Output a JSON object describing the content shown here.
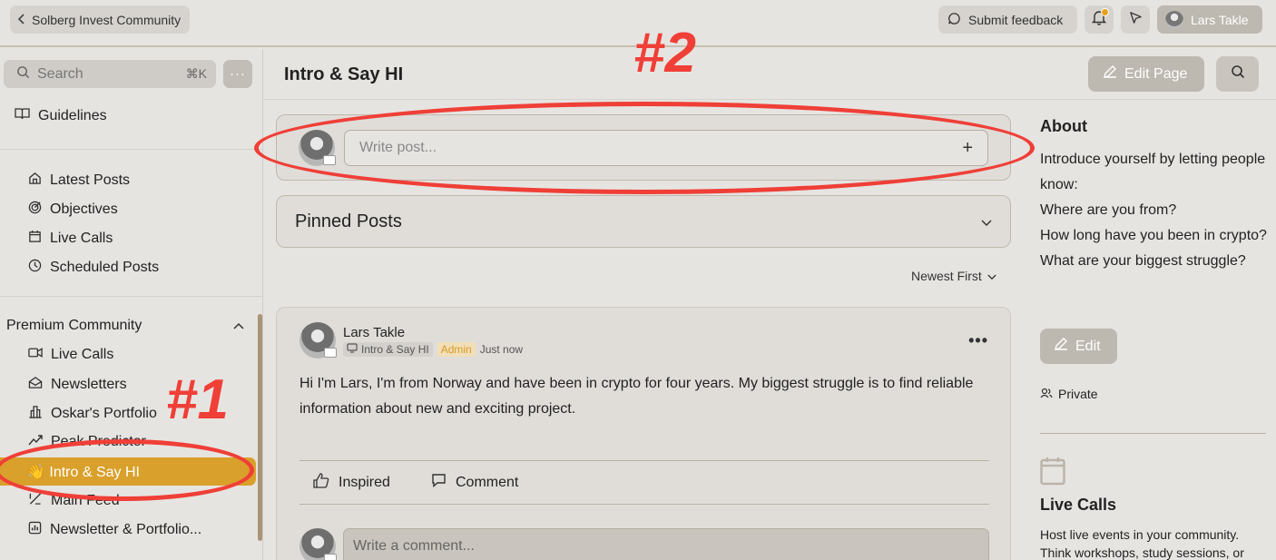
{
  "topbar": {
    "back_label": "Solberg Invest Community",
    "feedback_label": "Submit feedback",
    "user_name": "Lars Takle",
    "notification_accent": "#e6a11a"
  },
  "sidebar": {
    "search_placeholder": "Search",
    "search_shortcut": "⌘K",
    "more_label": "···",
    "guidelines": "Guidelines",
    "items": [
      {
        "label": "Latest Posts",
        "icon": "home-icon"
      },
      {
        "label": "Objectives",
        "icon": "target-icon"
      },
      {
        "label": "Live Calls",
        "icon": "calendar-icon"
      },
      {
        "label": "Scheduled Posts",
        "icon": "clock-icon"
      }
    ],
    "section_title": "Premium Community",
    "section_items": [
      {
        "label": "Live Calls",
        "icon": "video-icon"
      },
      {
        "label": "Newsletters",
        "icon": "mail-open-icon"
      },
      {
        "label": "Oskar's Portfolio",
        "icon": "building-icon"
      },
      {
        "label": "Peak Predictor",
        "icon": "trend-icon"
      },
      {
        "label": "👋 Intro & Say HI",
        "icon": "wave-emoji",
        "active": true
      },
      {
        "label": "Main Feed",
        "icon": "feed-icon"
      },
      {
        "label": "Newsletter & Portfolio...",
        "icon": "chart-icon"
      }
    ],
    "active_color": "#d9a02b"
  },
  "main": {
    "title": "Intro & Say HI",
    "edit_page_label": "Edit Page",
    "write_placeholder": "Write post...",
    "write_plus": "+",
    "pinned_title": "Pinned Posts",
    "sort_label": "Newest First"
  },
  "post": {
    "author": "Lars Takle",
    "space": "Intro & Say HI",
    "role": "Admin",
    "time": "Just now",
    "more": "•••",
    "body": "Hi I'm Lars, I'm from Norway and have been in crypto for four years. My biggest struggle is to find reliable information about new and exciting project.",
    "inspired_label": "Inspired",
    "comment_label": "Comment",
    "comment_placeholder": "Write a comment..."
  },
  "about": {
    "title": "About",
    "lines": [
      "Introduce yourself by letting people know:",
      "Where are you from?",
      "How long have you been in crypto?",
      "What are your biggest struggle?"
    ],
    "edit_label": "Edit",
    "privacy": "Private"
  },
  "live_calls": {
    "title": "Live Calls",
    "text": "Host live events in your community. Think workshops, study sessions, or"
  },
  "annotations": {
    "label_1": "#1",
    "label_2": "#2",
    "color": "#ef3f37"
  }
}
